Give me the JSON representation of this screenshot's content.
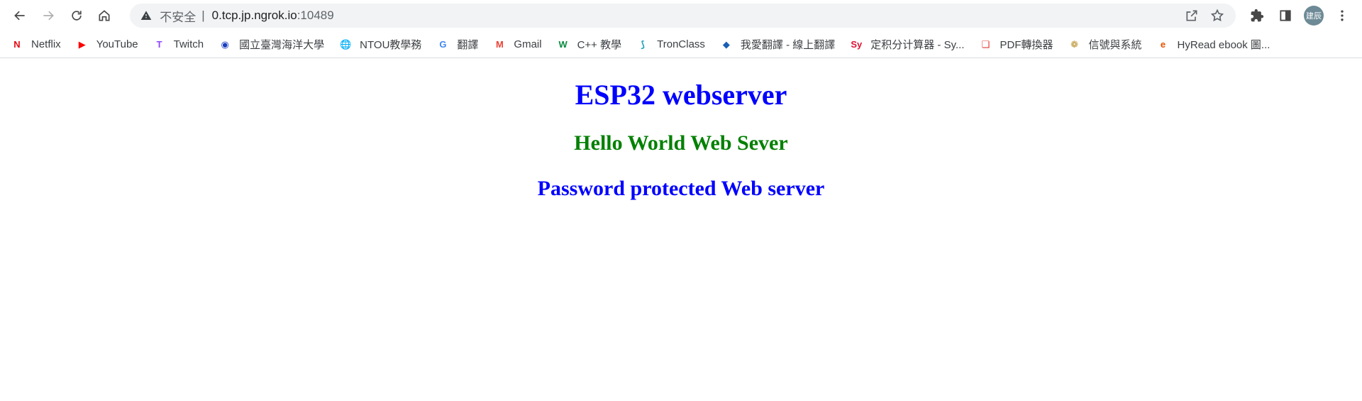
{
  "browser": {
    "address": {
      "insecure_label": "不安全",
      "separator": "|",
      "host": "0.tcp.jp.ngrok.io",
      "port": ":10489"
    },
    "profile": {
      "initials": "建辰"
    },
    "icons": {
      "back": "arrow-left-icon",
      "forward": "arrow-right-icon",
      "reload": "reload-icon",
      "home": "home-icon",
      "warning": "warning-triangle-icon",
      "share": "share-icon",
      "bookmark_star": "star-icon",
      "extensions": "puzzle-icon",
      "side_panel": "side-panel-icon",
      "menu": "kebab-menu-icon"
    }
  },
  "bookmarks": [
    {
      "label": "Netflix",
      "icon": "N",
      "color": "#e50914"
    },
    {
      "label": "YouTube",
      "icon": "▶",
      "color": "#ff0000"
    },
    {
      "label": "Twitch",
      "icon": "T",
      "color": "#9146ff"
    },
    {
      "label": "國立臺灣海洋大學",
      "icon": "◉",
      "color": "#1a3fbf"
    },
    {
      "label": "NTOU教學務",
      "icon": "🌐",
      "color": "#5f6368"
    },
    {
      "label": "翻譯",
      "icon": "G",
      "color": "#4285f4"
    },
    {
      "label": "Gmail",
      "icon": "M",
      "color": "#ea4335"
    },
    {
      "label": "C++ 教學",
      "icon": "W",
      "color": "#0b8a3f"
    },
    {
      "label": "TronClass",
      "icon": "⟆",
      "color": "#21a2b8"
    },
    {
      "label": "我愛翻譯 - 線上翻譯",
      "icon": "◆",
      "color": "#1a5fb4"
    },
    {
      "label": "定积分计算器 - Sy...",
      "icon": "Sy",
      "color": "#dd1133"
    },
    {
      "label": "PDF轉換器",
      "icon": "❑",
      "color": "#e53935"
    },
    {
      "label": "信號與系統",
      "icon": "❁",
      "color": "#b58f2a"
    },
    {
      "label": "HyRead ebook 圖...",
      "icon": "e",
      "color": "#e65100"
    }
  ],
  "page": {
    "heading": "ESP32 webserver",
    "subheading": "Hello World Web Sever",
    "subheading2": "Password protected Web server",
    "colors": {
      "heading": "#0000ff",
      "subheading": "#008000",
      "subheading2": "#0000ff"
    }
  }
}
